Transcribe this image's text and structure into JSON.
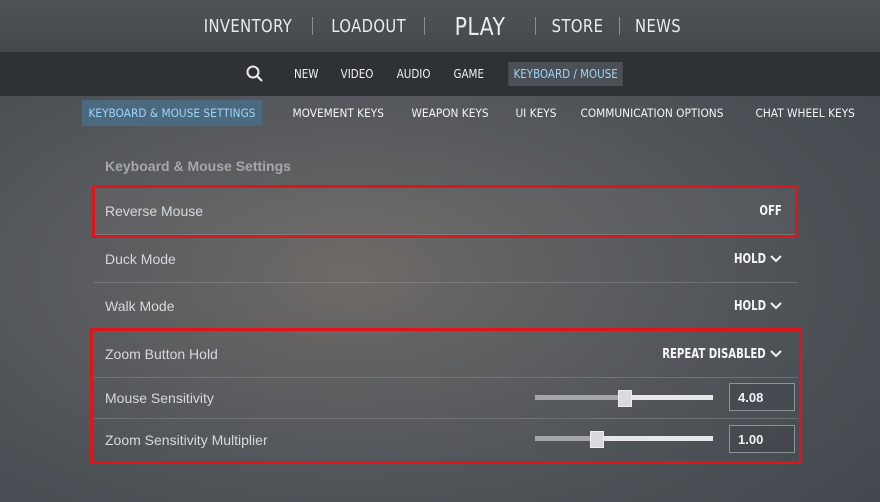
{
  "topnav": {
    "tabs": [
      "INVENTORY",
      "LOADOUT",
      "PLAY",
      "STORE",
      "NEWS"
    ]
  },
  "subnav": {
    "search_icon": "search-icon",
    "items": [
      "NEW",
      "VIDEO",
      "AUDIO",
      "GAME",
      "KEYBOARD / MOUSE"
    ],
    "active": "KEYBOARD / MOUSE"
  },
  "settings_tabs": {
    "items": [
      "KEYBOARD & MOUSE SETTINGS",
      "MOVEMENT KEYS",
      "WEAPON KEYS",
      "UI KEYS",
      "COMMUNICATION OPTIONS",
      "CHAT WHEEL KEYS"
    ],
    "active": "KEYBOARD & MOUSE SETTINGS"
  },
  "section": {
    "title": "Keyboard & Mouse Settings"
  },
  "settings": {
    "reverse_mouse": {
      "label": "Reverse Mouse",
      "value": "OFF"
    },
    "duck_mode": {
      "label": "Duck Mode",
      "value": "HOLD"
    },
    "walk_mode": {
      "label": "Walk Mode",
      "value": "HOLD"
    },
    "zoom_button_hold": {
      "label": "Zoom Button Hold",
      "value": "REPEAT DISABLED"
    },
    "mouse_sensitivity": {
      "label": "Mouse Sensitivity",
      "value": "4.08",
      "slider_fraction": 0.5
    },
    "zoom_sensitivity": {
      "label": "Zoom Sensitivity Multiplier",
      "value": "1.00",
      "slider_fraction": 0.34
    }
  },
  "colors": {
    "highlight": "#e0141b",
    "active_tab_text": "#9fd3f5"
  }
}
